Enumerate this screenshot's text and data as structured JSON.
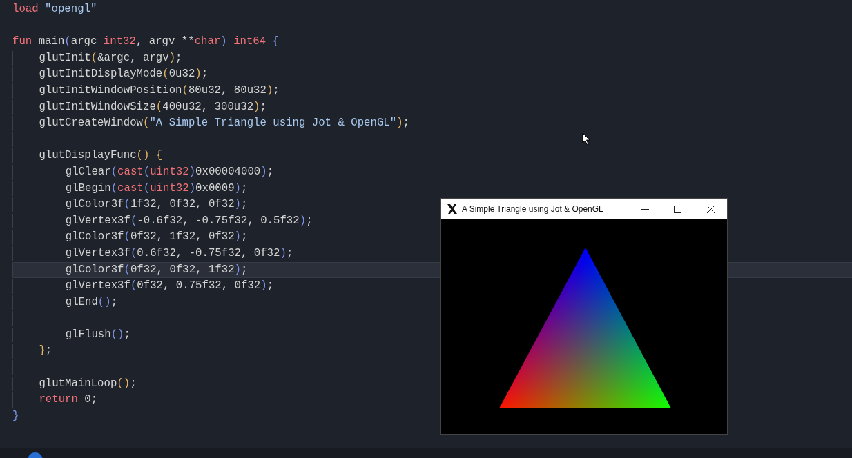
{
  "editor": {
    "lines": [
      {
        "kind": "code",
        "current": false,
        "tokens": [
          {
            "kind": "keyword",
            "text": "load"
          },
          {
            "kind": "string",
            "text": " \"opengl\""
          }
        ]
      },
      {
        "kind": "blank",
        "current": false
      },
      {
        "kind": "code",
        "current": false,
        "tokens": [
          {
            "kind": "keyword",
            "text": "fun"
          },
          {
            "kind": "plain",
            "text": " main"
          },
          {
            "kind": "subbracket",
            "text": "("
          },
          {
            "kind": "plain",
            "text": "argc "
          },
          {
            "kind": "keyword",
            "text": "int32"
          },
          {
            "kind": "plain",
            "text": ", argv **"
          },
          {
            "kind": "keyword",
            "text": "char"
          },
          {
            "kind": "subbracket",
            "text": ")"
          },
          {
            "kind": "keyword",
            "text": " int64"
          },
          {
            "kind": "subbracket",
            "text": " {"
          }
        ],
        "children": [
          {
            "kind": "code",
            "current": false,
            "tokens": [
              {
                "kind": "plain",
                "text": "glutInit"
              },
              {
                "kind": "bracket",
                "text": "("
              },
              {
                "kind": "plain",
                "text": "&argc, argv"
              },
              {
                "kind": "bracket",
                "text": ")"
              },
              {
                "kind": "plain",
                "text": ";"
              }
            ]
          },
          {
            "kind": "code",
            "current": false,
            "tokens": [
              {
                "kind": "plain",
                "text": "glutInitDisplayMode"
              },
              {
                "kind": "bracket",
                "text": "("
              },
              {
                "kind": "plain",
                "text": "0u32"
              },
              {
                "kind": "bracket",
                "text": ")"
              },
              {
                "kind": "plain",
                "text": ";"
              }
            ]
          },
          {
            "kind": "code",
            "current": false,
            "tokens": [
              {
                "kind": "plain",
                "text": "glutInitWindowPosition"
              },
              {
                "kind": "bracket",
                "text": "("
              },
              {
                "kind": "plain",
                "text": "80u32, 80u32"
              },
              {
                "kind": "bracket",
                "text": ")"
              },
              {
                "kind": "plain",
                "text": ";"
              }
            ]
          },
          {
            "kind": "code",
            "current": false,
            "tokens": [
              {
                "kind": "plain",
                "text": "glutInitWindowSize"
              },
              {
                "kind": "bracket",
                "text": "("
              },
              {
                "kind": "plain",
                "text": "400u32, 300u32"
              },
              {
                "kind": "bracket",
                "text": ")"
              },
              {
                "kind": "plain",
                "text": ";"
              }
            ]
          },
          {
            "kind": "code",
            "current": false,
            "tokens": [
              {
                "kind": "plain",
                "text": "glutCreateWindow"
              },
              {
                "kind": "bracket",
                "text": "("
              },
              {
                "kind": "string",
                "text": "\"A Simple Triangle using Jot & OpenGL\""
              },
              {
                "kind": "bracket",
                "text": ")"
              },
              {
                "kind": "plain",
                "text": ";"
              }
            ]
          },
          {
            "kind": "blank",
            "current": false
          },
          {
            "kind": "code",
            "current": false,
            "tokens": [
              {
                "kind": "plain",
                "text": "glutDisplayFunc"
              },
              {
                "kind": "bracket",
                "text": "()"
              },
              {
                "kind": "bracket",
                "text": " {"
              }
            ],
            "children": [
              {
                "kind": "code",
                "current": false,
                "tokens": [
                  {
                    "kind": "plain",
                    "text": "glClear"
                  },
                  {
                    "kind": "subbracket",
                    "text": "("
                  },
                  {
                    "kind": "keyword",
                    "text": "cast"
                  },
                  {
                    "kind": "subbracket",
                    "text": "("
                  },
                  {
                    "kind": "keyword",
                    "text": "uint32"
                  },
                  {
                    "kind": "subbracket",
                    "text": ")"
                  },
                  {
                    "kind": "plain",
                    "text": "0x00004000"
                  },
                  {
                    "kind": "subbracket",
                    "text": ")"
                  },
                  {
                    "kind": "plain",
                    "text": ";"
                  }
                ]
              },
              {
                "kind": "code",
                "current": false,
                "tokens": [
                  {
                    "kind": "plain",
                    "text": "glBegin"
                  },
                  {
                    "kind": "subbracket",
                    "text": "("
                  },
                  {
                    "kind": "keyword",
                    "text": "cast"
                  },
                  {
                    "kind": "subbracket",
                    "text": "("
                  },
                  {
                    "kind": "keyword",
                    "text": "uint32"
                  },
                  {
                    "kind": "subbracket",
                    "text": ")"
                  },
                  {
                    "kind": "plain",
                    "text": "0x0009"
                  },
                  {
                    "kind": "subbracket",
                    "text": ")"
                  },
                  {
                    "kind": "plain",
                    "text": ";"
                  }
                ]
              },
              {
                "kind": "code",
                "current": false,
                "tokens": [
                  {
                    "kind": "plain",
                    "text": "glColor3f"
                  },
                  {
                    "kind": "subbracket",
                    "text": "("
                  },
                  {
                    "kind": "plain",
                    "text": "1f32, 0f32, 0f32"
                  },
                  {
                    "kind": "subbracket",
                    "text": ")"
                  },
                  {
                    "kind": "plain",
                    "text": ";"
                  }
                ]
              },
              {
                "kind": "code",
                "current": false,
                "tokens": [
                  {
                    "kind": "plain",
                    "text": "glVertex3f"
                  },
                  {
                    "kind": "subbracket",
                    "text": "("
                  },
                  {
                    "kind": "plain",
                    "text": "-0.6f32, -0.75f32, 0.5f32"
                  },
                  {
                    "kind": "subbracket",
                    "text": ")"
                  },
                  {
                    "kind": "plain",
                    "text": ";"
                  }
                ]
              },
              {
                "kind": "code",
                "current": false,
                "tokens": [
                  {
                    "kind": "plain",
                    "text": "glColor3f"
                  },
                  {
                    "kind": "subbracket",
                    "text": "("
                  },
                  {
                    "kind": "plain",
                    "text": "0f32, 1f32, 0f32"
                  },
                  {
                    "kind": "subbracket",
                    "text": ")"
                  },
                  {
                    "kind": "plain",
                    "text": ";"
                  }
                ]
              },
              {
                "kind": "code",
                "current": false,
                "tokens": [
                  {
                    "kind": "plain",
                    "text": "glVertex3f"
                  },
                  {
                    "kind": "subbracket",
                    "text": "("
                  },
                  {
                    "kind": "plain",
                    "text": "0.6f32, -0.75f32, 0f32"
                  },
                  {
                    "kind": "subbracket",
                    "text": ")"
                  },
                  {
                    "kind": "plain",
                    "text": ";"
                  }
                ]
              },
              {
                "kind": "code",
                "current": true,
                "tokens": [
                  {
                    "kind": "plain",
                    "text": "glColor3f"
                  },
                  {
                    "kind": "subbracket",
                    "text": "("
                  },
                  {
                    "kind": "plain",
                    "text": "0f32, 0f32, 1f32"
                  },
                  {
                    "kind": "subbracket",
                    "text": ")"
                  },
                  {
                    "kind": "plain",
                    "text": ";"
                  }
                ]
              },
              {
                "kind": "code",
                "current": false,
                "tokens": [
                  {
                    "kind": "plain",
                    "text": "glVertex3f"
                  },
                  {
                    "kind": "subbracket",
                    "text": "("
                  },
                  {
                    "kind": "plain",
                    "text": "0f32, 0.75f32, 0f32"
                  },
                  {
                    "kind": "subbracket",
                    "text": ")"
                  },
                  {
                    "kind": "plain",
                    "text": ";"
                  }
                ]
              },
              {
                "kind": "code",
                "current": false,
                "tokens": [
                  {
                    "kind": "plain",
                    "text": "glEnd"
                  },
                  {
                    "kind": "subbracket",
                    "text": "()"
                  },
                  {
                    "kind": "plain",
                    "text": ";"
                  }
                ]
              },
              {
                "kind": "blank",
                "current": false
              },
              {
                "kind": "code",
                "current": false,
                "tokens": [
                  {
                    "kind": "plain",
                    "text": "glFlush"
                  },
                  {
                    "kind": "subbracket",
                    "text": "()"
                  },
                  {
                    "kind": "plain",
                    "text": ";"
                  }
                ]
              }
            ]
          },
          {
            "kind": "code",
            "current": false,
            "tokens": [
              {
                "kind": "bracket",
                "text": "}"
              },
              {
                "kind": "plain",
                "text": ";"
              }
            ]
          },
          {
            "kind": "blank",
            "current": false
          },
          {
            "kind": "code",
            "current": false,
            "tokens": [
              {
                "kind": "plain",
                "text": "glutMainLoop"
              },
              {
                "kind": "bracket",
                "text": "()"
              },
              {
                "kind": "plain",
                "text": ";"
              }
            ]
          },
          {
            "kind": "code",
            "current": false,
            "tokens": [
              {
                "kind": "keyword",
                "text": "return"
              },
              {
                "kind": "plain",
                "text": " 0;"
              }
            ]
          }
        ]
      },
      {
        "kind": "code",
        "current": false,
        "tokens": [
          {
            "kind": "subbracket",
            "text": "}"
          }
        ]
      }
    ]
  },
  "app_window": {
    "title": "A Simple Triangle using Jot & OpenGL"
  }
}
